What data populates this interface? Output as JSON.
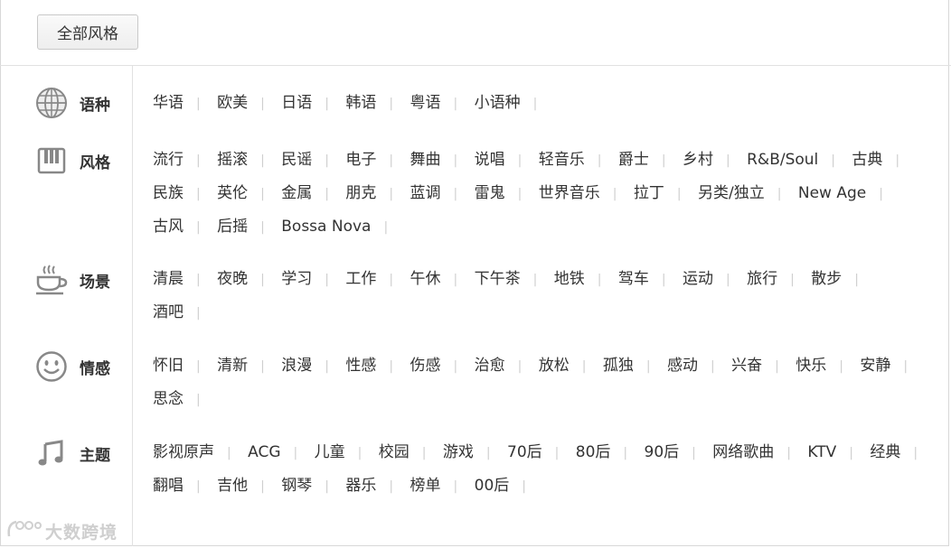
{
  "all_button": "全部风格",
  "categories": [
    {
      "name": "语种",
      "icon": "globe-icon",
      "tags": [
        "华语",
        "欧美",
        "日语",
        "韩语",
        "粤语",
        "小语种"
      ]
    },
    {
      "name": "风格",
      "icon": "piano-keys-icon",
      "tags": [
        "流行",
        "摇滚",
        "民谣",
        "电子",
        "舞曲",
        "说唱",
        "轻音乐",
        "爵士",
        "乡村",
        "R&B/Soul",
        "古典",
        "民族",
        "英伦",
        "金属",
        "朋克",
        "蓝调",
        "雷鬼",
        "世界音乐",
        "拉丁",
        "另类/独立",
        "New Age",
        "古风",
        "后摇",
        "Bossa Nova"
      ]
    },
    {
      "name": "场景",
      "icon": "coffee-cup-icon",
      "tags": [
        "清晨",
        "夜晚",
        "学习",
        "工作",
        "午休",
        "下午茶",
        "地铁",
        "驾车",
        "运动",
        "旅行",
        "散步",
        "酒吧"
      ]
    },
    {
      "name": "情感",
      "icon": "smiley-icon",
      "tags": [
        "怀旧",
        "清新",
        "浪漫",
        "性感",
        "伤感",
        "治愈",
        "放松",
        "孤独",
        "感动",
        "兴奋",
        "快乐",
        "安静",
        "思念"
      ]
    },
    {
      "name": "主题",
      "icon": "music-note-icon",
      "tags": [
        "影视原声",
        "ACG",
        "儿童",
        "校园",
        "游戏",
        "70后",
        "80后",
        "90后",
        "网络歌曲",
        "KTV",
        "经典",
        "翻唱",
        "吉他",
        "钢琴",
        "器乐",
        "榜单",
        "00后"
      ]
    }
  ],
  "watermark": "大数跨境"
}
